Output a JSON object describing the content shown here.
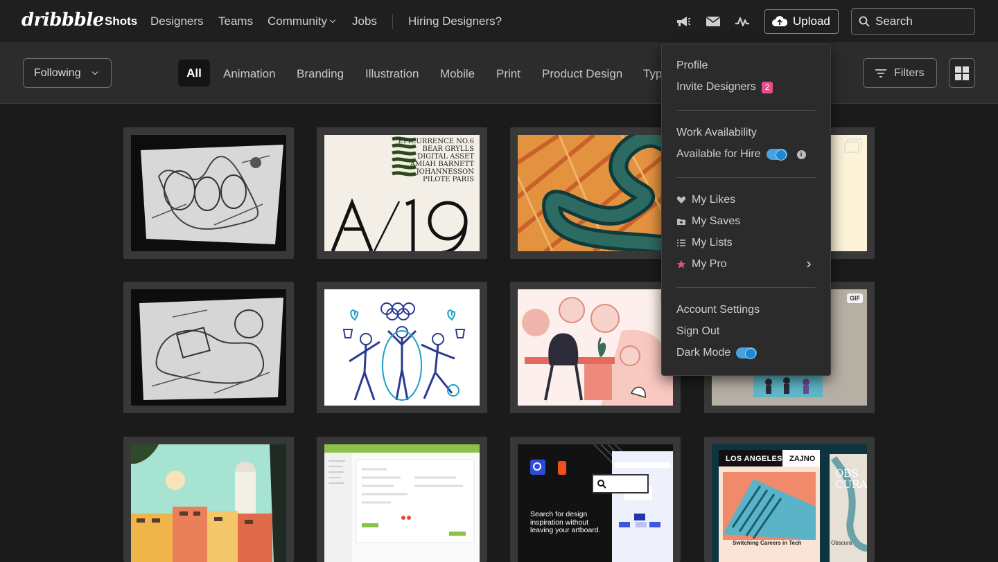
{
  "brand": {
    "logo_text": "dribbble"
  },
  "topnav": {
    "links": [
      "Shots",
      "Designers",
      "Teams",
      "Community",
      "Jobs"
    ],
    "hiring_link": "Hiring Designers?",
    "icons": [
      "megaphone-icon",
      "mail-icon",
      "activity-icon"
    ],
    "upload_label": "Upload",
    "search_placeholder": "Search"
  },
  "filterbar": {
    "following_label": "Following",
    "categories": [
      "All",
      "Animation",
      "Branding",
      "Illustration",
      "Mobile",
      "Print",
      "Product Design",
      "Typ"
    ],
    "filters_label": "Filters"
  },
  "shots": {
    "row1": {
      "text_lines": [
        "EPICURRENCE NO.6",
        "BEAR GRYLLS",
        "DIGITAL ASSET",
        "AMIAH BARNETT",
        "JOHANNESSON",
        "PILOTE PARIS"
      ],
      "big_text": "A/19"
    },
    "row2": {
      "gif_badge": "GIF"
    },
    "row3": {
      "search_tagline": "Search for design inspiration without leaving your artboard.",
      "poster_city": "LOS ANGELES",
      "poster_brand": "ZAJNO",
      "poster_side": "OBS CURA",
      "poster_caption": "Switching Careers in Tech",
      "poster_side_caption": "Obscura"
    }
  },
  "dropdown": {
    "profile": "Profile",
    "invite": "Invite Designers",
    "invite_badge": "2",
    "work_availability": "Work Availability",
    "available_for_hire": "Available for Hire",
    "info_glyph": "i",
    "my_likes": "My Likes",
    "my_saves": "My Saves",
    "my_lists": "My Lists",
    "my_pro": "My Pro",
    "account_settings": "Account Settings",
    "sign_out": "Sign Out",
    "dark_mode": "Dark Mode",
    "available_for_hire_on": true,
    "dark_mode_on": true
  },
  "colors": {
    "accent_pink": "#ea4c89",
    "toggle_blue": "#4aa3df",
    "bg": "#1b1b1b"
  }
}
